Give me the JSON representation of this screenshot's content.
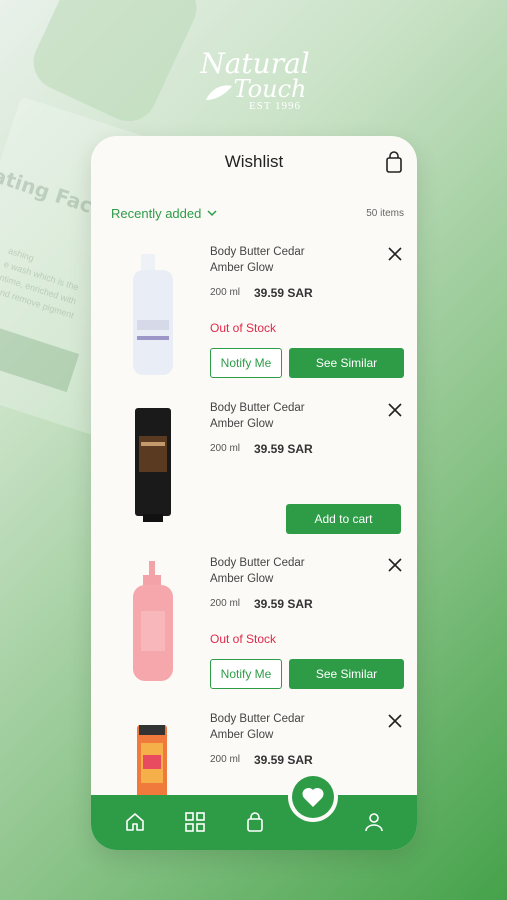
{
  "brand": {
    "name_line1": "Natural",
    "name_line2": "Touch",
    "established": "EST 1996"
  },
  "background": {
    "headline": "ating Face W",
    "body_line1": "ashing",
    "body_line2": "e wash which is the",
    "body_line3": "ntime, enriched with",
    "body_line4": "and remove pigment"
  },
  "header": {
    "title": "Wishlist",
    "cart_icon": "shopping-bag-icon"
  },
  "subbar": {
    "sort_label": "Recently added",
    "item_count": "50 items"
  },
  "items": [
    {
      "name": "Body Butter Cedar Amber Glow",
      "size": "200 ml",
      "price": "39.59 SAR",
      "stock_status": "Out of Stock",
      "notify_label": "Notify Me",
      "similar_label": "See Similar",
      "image": "white-lotion-bottle"
    },
    {
      "name": "Body Butter Cedar Amber Glow",
      "size": "200 ml",
      "price": "39.59 SAR",
      "cart_label": "Add to cart",
      "image": "black-tube"
    },
    {
      "name": "Body Butter Cedar Amber Glow",
      "size": "200 ml",
      "price": "39.59 SAR",
      "stock_status": "Out of Stock",
      "notify_label": "Notify Me",
      "similar_label": "See Similar",
      "image": "pink-pump-bottle"
    },
    {
      "name": "Body Butter Cedar Amber Glow",
      "size": "200 ml",
      "price": "39.59 SAR",
      "image": "orange-tube"
    }
  ],
  "nav": {
    "items": [
      "home-icon",
      "grid-icon",
      "bag-icon",
      "heart-icon",
      "user-icon"
    ],
    "active": "heart-icon"
  },
  "colors": {
    "accent": "#2e9c47",
    "out_of_stock": "#e0294a",
    "card_bg": "#fbfaf7"
  }
}
